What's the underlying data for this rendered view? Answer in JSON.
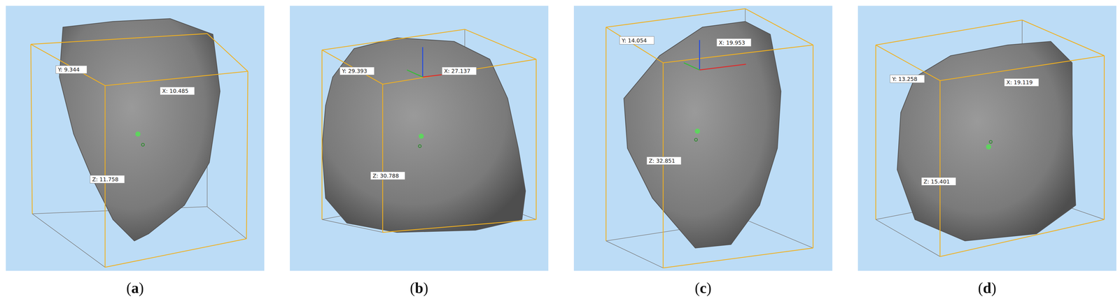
{
  "panels": [
    {
      "caption_open": "(",
      "caption_letter": "a",
      "caption_close": ")",
      "labels": {
        "y": "Y: 9.344",
        "x": "X: 10.485",
        "z": "Z: 11.758"
      }
    },
    {
      "caption_open": "(",
      "caption_letter": "b",
      "caption_close": ")",
      "labels": {
        "y": "Y: 29.393",
        "x": "X: 27.137",
        "z": "Z: 30.788"
      }
    },
    {
      "caption_open": "(",
      "caption_letter": "c",
      "caption_close": ")",
      "labels": {
        "y": "Y: 14.054",
        "x": "X: 19.953",
        "z": "Z: 32.851"
      }
    },
    {
      "caption_open": "(",
      "caption_letter": "d",
      "caption_close": ")",
      "labels": {
        "y": "Y: 13.258",
        "x": "X: 19.119",
        "z": "Z: 15.401"
      }
    }
  ]
}
